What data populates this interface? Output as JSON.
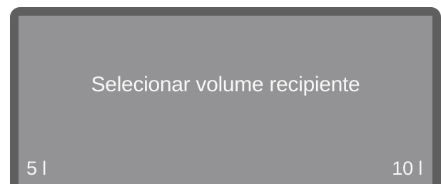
{
  "display": {
    "prompt": "Selecionar volume recipiente",
    "options": {
      "left": "5 l",
      "right": "10 l"
    }
  },
  "colors": {
    "bezel": "#5f5f5f",
    "screen": "#939395",
    "text": "#f7f7f7"
  }
}
